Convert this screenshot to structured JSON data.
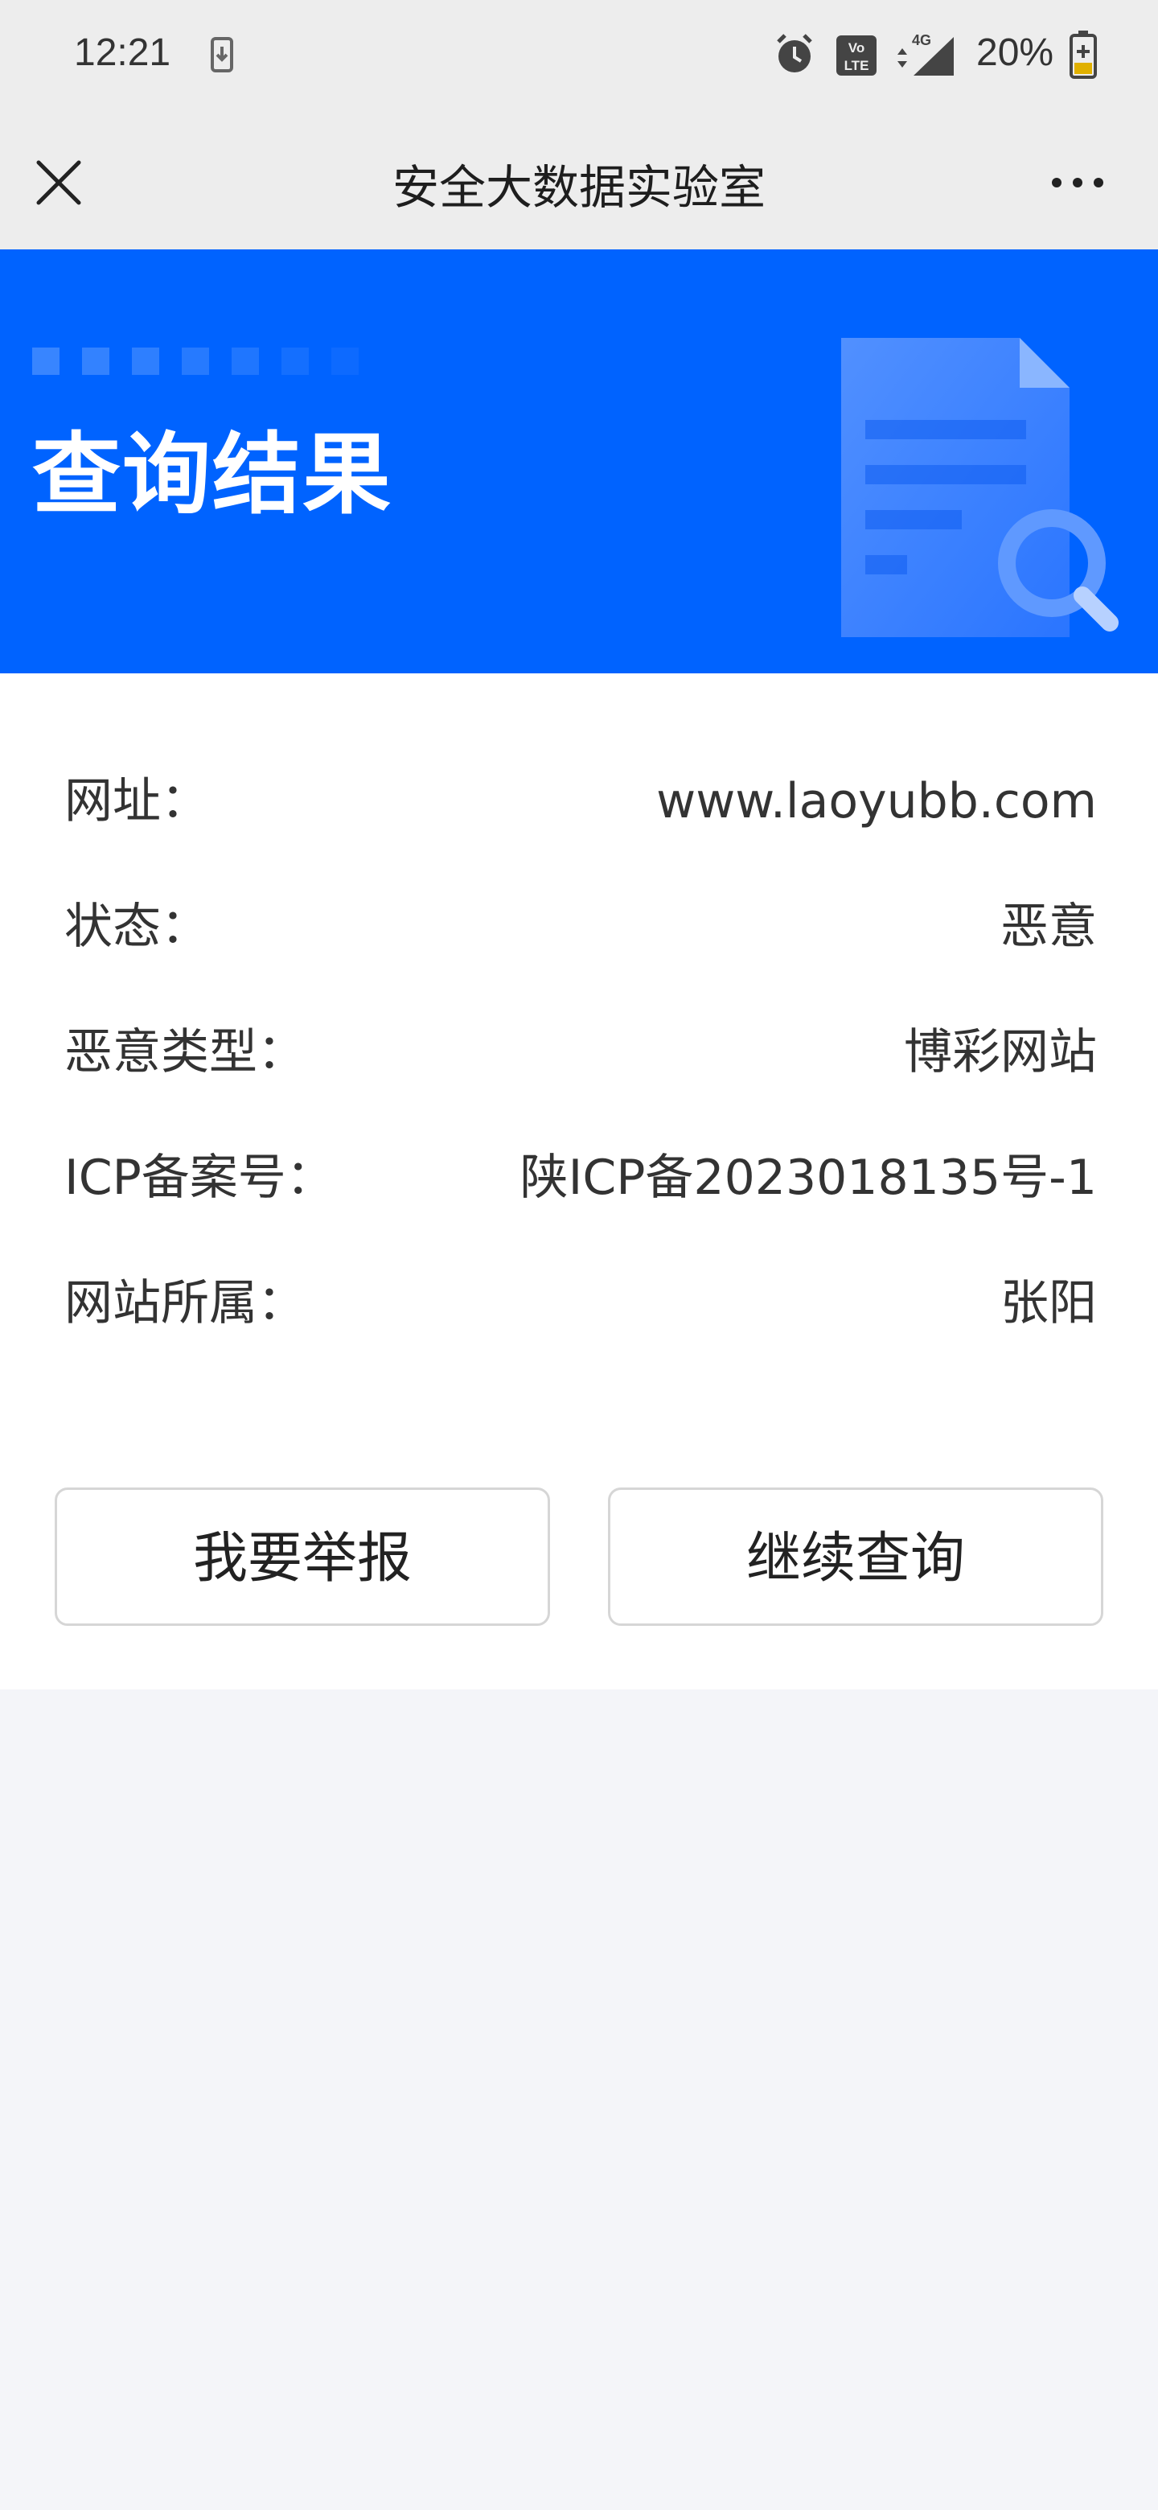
{
  "status_bar": {
    "time": "12:21",
    "battery": "20%",
    "icons": [
      "download-icon",
      "alarm-icon",
      "volte-icon",
      "signal-4g-icon",
      "battery-icon"
    ]
  },
  "app_bar": {
    "title": "安全大数据实验室",
    "close_icon": "close-icon",
    "more_icon": "more-icon"
  },
  "banner": {
    "title": "查询结果",
    "accent_color": "#0063ff"
  },
  "result": {
    "rows": [
      {
        "label": "网址：",
        "value": "www.laoyubb.com"
      },
      {
        "label": "状态：",
        "value": "恶意"
      },
      {
        "label": "恶意类型：",
        "value": "博彩网站"
      },
      {
        "label": "ICP备案号：",
        "value": "陕ICP备2023018135号-1"
      },
      {
        "label": "网站所属：",
        "value": "张阳"
      }
    ]
  },
  "actions": {
    "report_label": "我要举报",
    "continue_label": "继续查询"
  }
}
